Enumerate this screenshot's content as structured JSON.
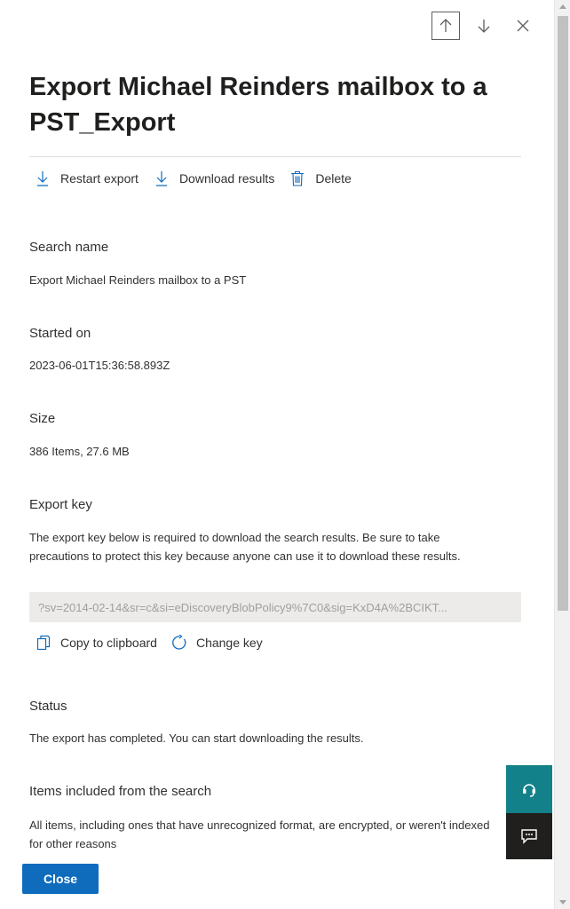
{
  "nav": {
    "up_icon": "arrow-up-icon",
    "down_icon": "arrow-down-icon",
    "close_icon": "close-icon"
  },
  "title": "Export Michael Reinders mailbox to a PST_Export",
  "toolbar": {
    "restart_label": "Restart export",
    "download_label": "Download results",
    "delete_label": "Delete"
  },
  "search_name": {
    "label": "Search name",
    "value": "Export Michael Reinders mailbox to a PST"
  },
  "started_on": {
    "label": "Started on",
    "value": "2023-06-01T15:36:58.893Z"
  },
  "size": {
    "label": "Size",
    "value": "386 Items, 27.6 MB"
  },
  "export_key": {
    "label": "Export key",
    "description": "The export key below is required to download the search results. Be sure to take precautions to protect this key because anyone can use it to download these results.",
    "key_value": "?sv=2014-02-14&sr=c&si=eDiscoveryBlobPolicy9%7C0&sig=KxD4A%2BCIKT...",
    "copy_label": "Copy to clipboard",
    "change_label": "Change key"
  },
  "status": {
    "label": "Status",
    "value": "The export has completed. You can start downloading the results."
  },
  "items_included": {
    "label": "Items included from the search",
    "value": "All items, including ones that have unrecognized format, are encrypted, or weren't indexed for other reasons"
  },
  "footer": {
    "close_label": "Close"
  },
  "colors": {
    "accent": "#0f6cbd",
    "help_bg": "#13818a",
    "feedback_bg": "#201f1e",
    "key_box_bg": "#edebe9"
  }
}
